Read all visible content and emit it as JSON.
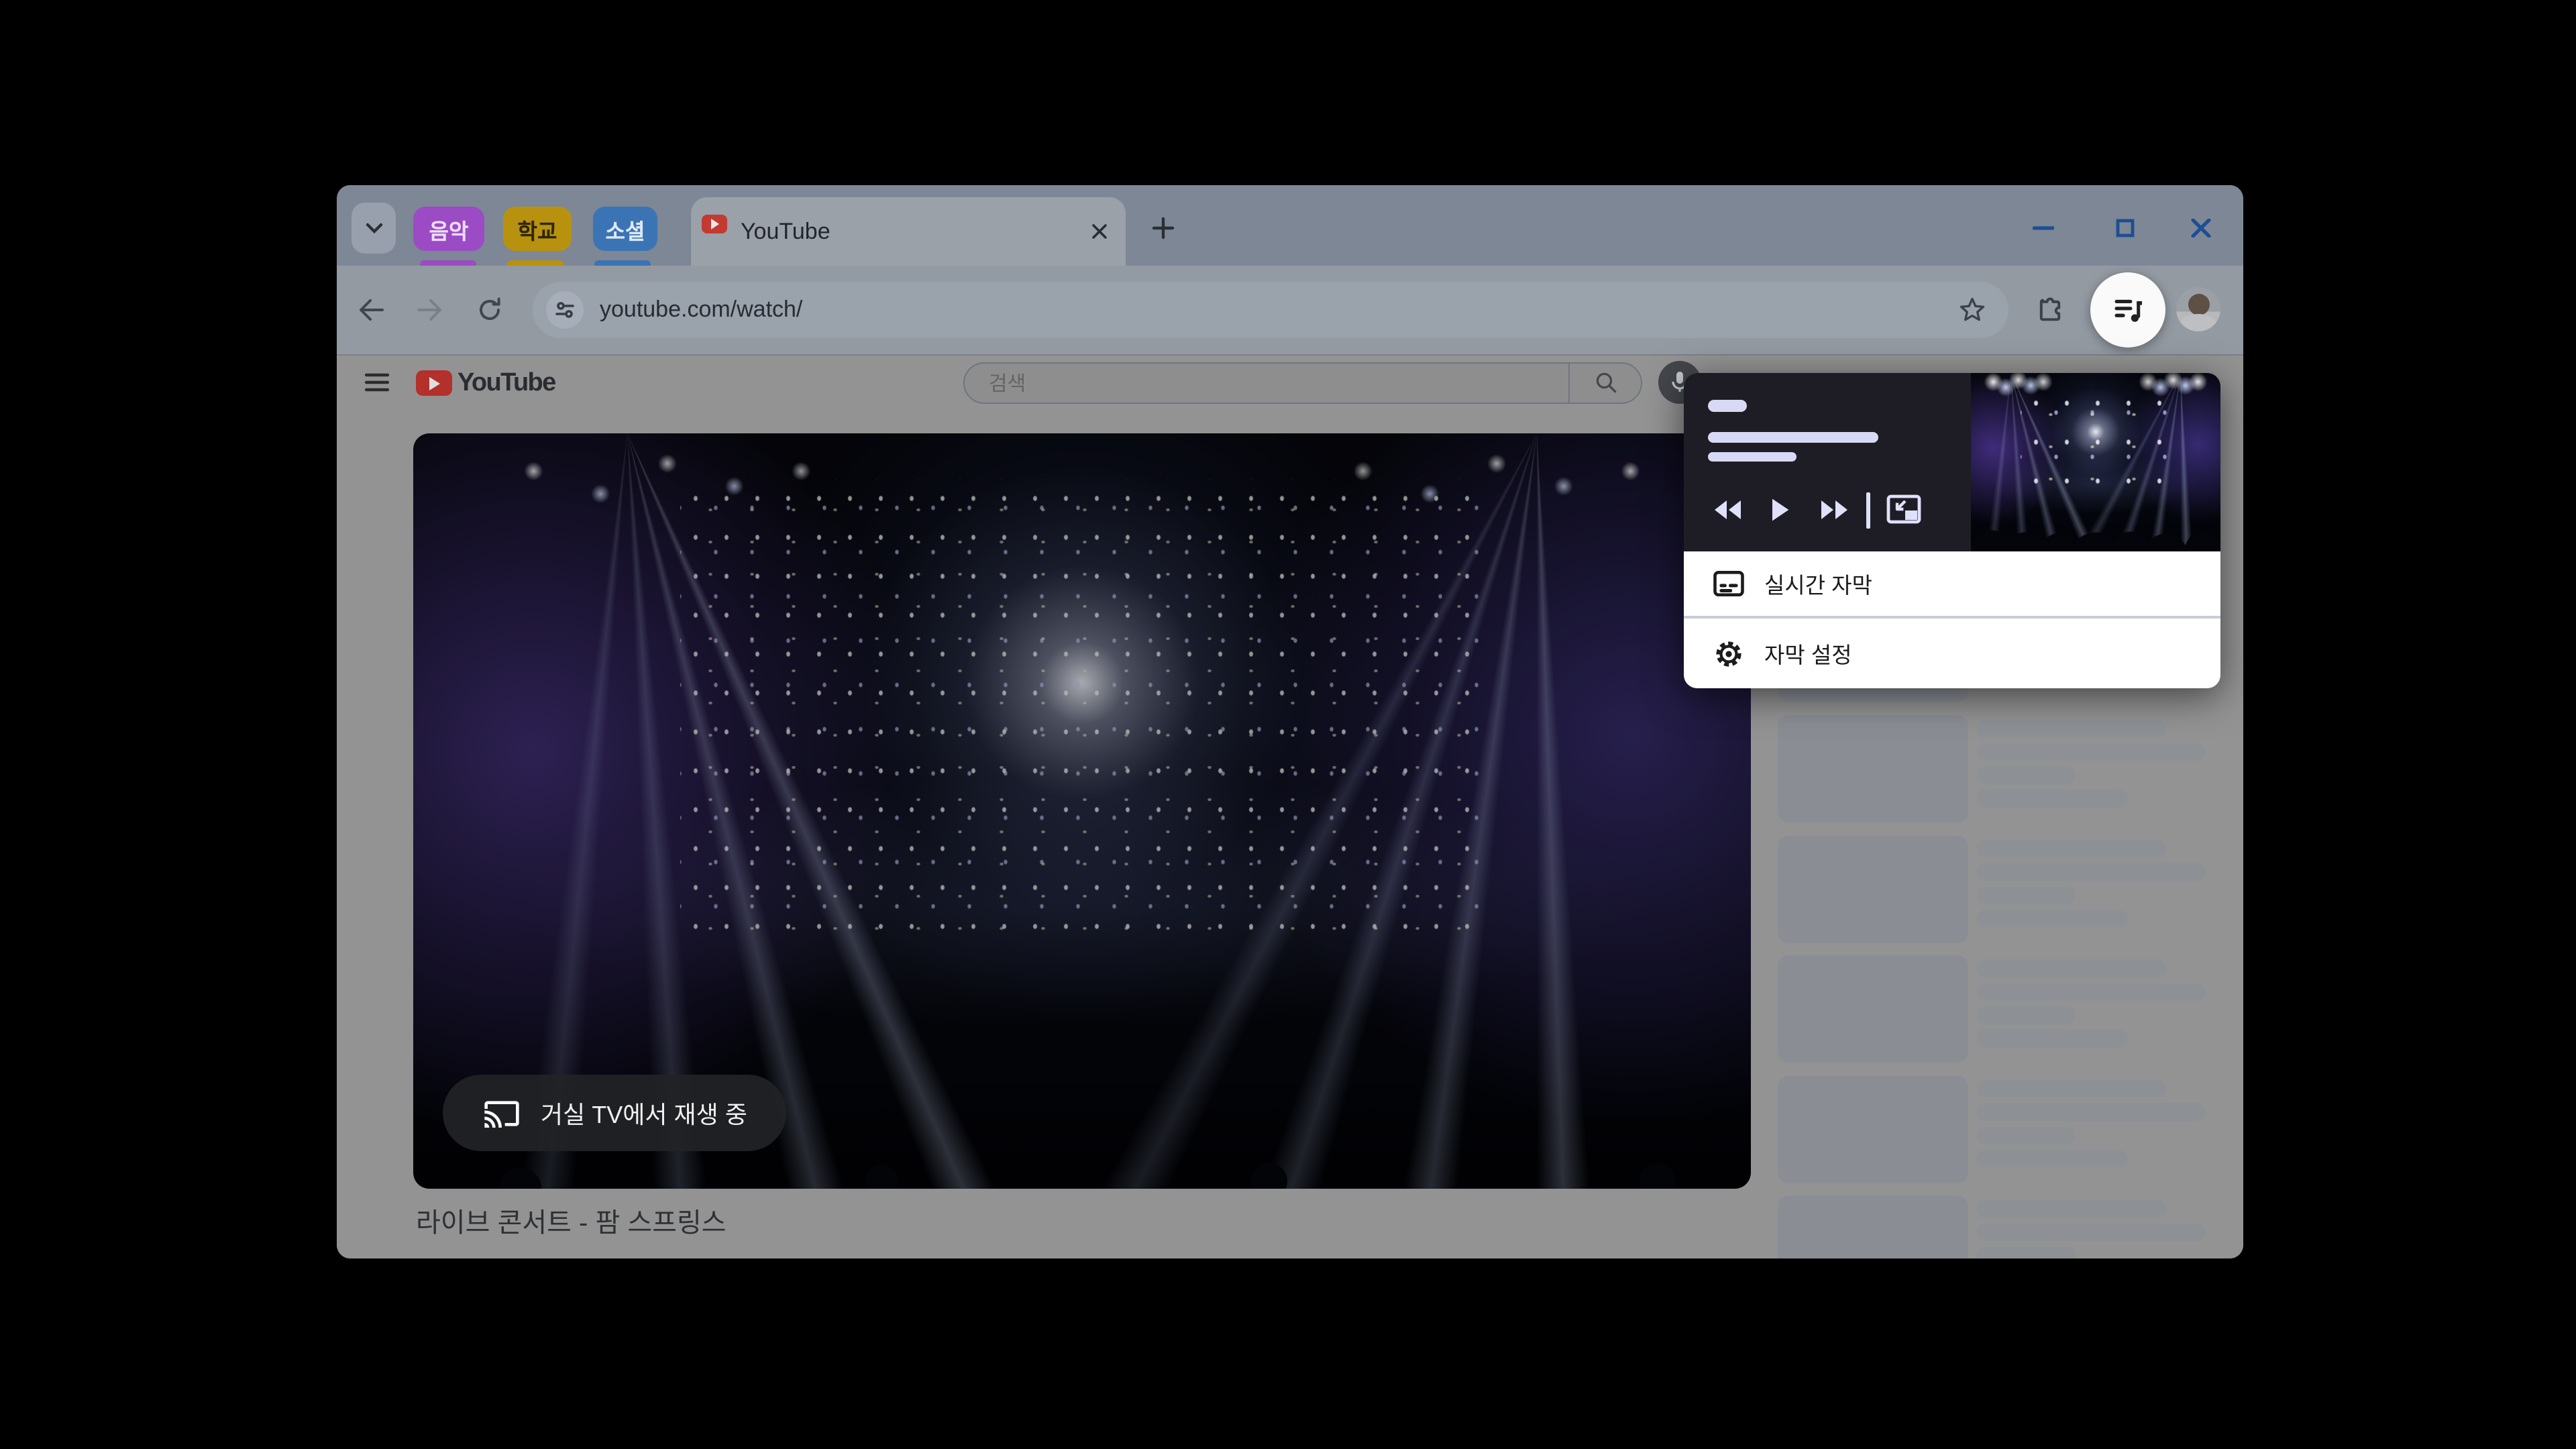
{
  "tab_strip": {
    "groups": [
      {
        "label": "음악",
        "color": "#9b4bc4"
      },
      {
        "label": "학교",
        "color": "#b8920f"
      },
      {
        "label": "소셜",
        "color": "#3a74b5"
      }
    ],
    "active_tab": {
      "title": "YouTube"
    }
  },
  "toolbar": {
    "url": "youtube.com/watch/"
  },
  "window_controls": {
    "accent_color": "#1d4e94"
  },
  "youtube": {
    "logo_text": "YouTube",
    "search_placeholder": "검색",
    "video_title": "라이브 콘서트 - 팜 스프링스",
    "cast_status": "거실 TV에서 재생 중"
  },
  "media_popup": {
    "live_caption_label": "실시간 자막",
    "live_caption_enabled": false,
    "caption_settings_label": "자막 설정"
  },
  "sidebar": {
    "skeleton_item_count": 6
  }
}
